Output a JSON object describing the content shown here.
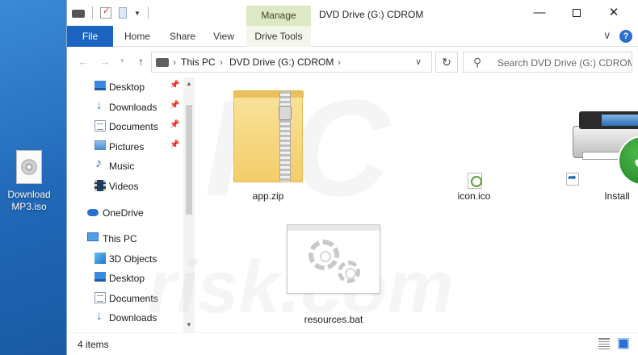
{
  "desktop": {
    "icon_label": "Download MP3.iso"
  },
  "window": {
    "title": "DVD Drive (G:) CDROM",
    "manage_label": "Manage",
    "min_glyph": "—",
    "close_glyph": "✕"
  },
  "ribbon": {
    "tabs": [
      "File",
      "Home",
      "Share",
      "View",
      "Drive Tools"
    ],
    "collapse_glyph": "∨",
    "help_glyph": "?"
  },
  "nav": {
    "back_glyph": "←",
    "forward_glyph": "→",
    "recent_glyph": "▾",
    "up_glyph": "↑",
    "address": [
      "This PC",
      "DVD Drive (G:) CDROM"
    ],
    "address_sep": "›",
    "address_dd": "∨",
    "refresh_glyph": "↻",
    "search_glyph": "⚲",
    "search_placeholder": "Search DVD Drive (G:) CDROM"
  },
  "sidebar": {
    "pin_glyph": "📌",
    "items": [
      {
        "label": "Desktop",
        "icon": "desktop-icon",
        "pinned": true
      },
      {
        "label": "Downloads",
        "icon": "downloads-icon",
        "pinned": true
      },
      {
        "label": "Documents",
        "icon": "documents-icon",
        "pinned": true
      },
      {
        "label": "Pictures",
        "icon": "pictures-icon",
        "pinned": true
      },
      {
        "label": "Music",
        "icon": "music-icon",
        "pinned": false
      },
      {
        "label": "Videos",
        "icon": "videos-icon",
        "pinned": false
      },
      {
        "label": "OneDrive",
        "icon": "onedrive-icon",
        "pinned": false
      },
      {
        "label": "This PC",
        "icon": "this-pc-icon",
        "pinned": false
      },
      {
        "label": "3D Objects",
        "icon": "3d-objects-icon",
        "pinned": false
      },
      {
        "label": "Desktop",
        "icon": "desktop-icon",
        "pinned": false
      },
      {
        "label": "Documents",
        "icon": "documents-icon",
        "pinned": false
      },
      {
        "label": "Downloads",
        "icon": "downloads-icon",
        "pinned": false
      }
    ]
  },
  "files": [
    {
      "name": "app.zip",
      "icon": "zip-folder-icon"
    },
    {
      "name": "icon.ico",
      "icon": "ico-file-icon"
    },
    {
      "name": "Install",
      "icon": "installer-icon"
    },
    {
      "name": "resources.bat",
      "icon": "batch-file-icon"
    }
  ],
  "status": {
    "item_count": "4 items"
  },
  "watermark": {
    "big": "PC",
    "site": "risk.com"
  },
  "colors": {
    "accent": "#1c64c2",
    "manage_tab": "#dde8c4",
    "desktop_bg": "#2a78c8"
  }
}
